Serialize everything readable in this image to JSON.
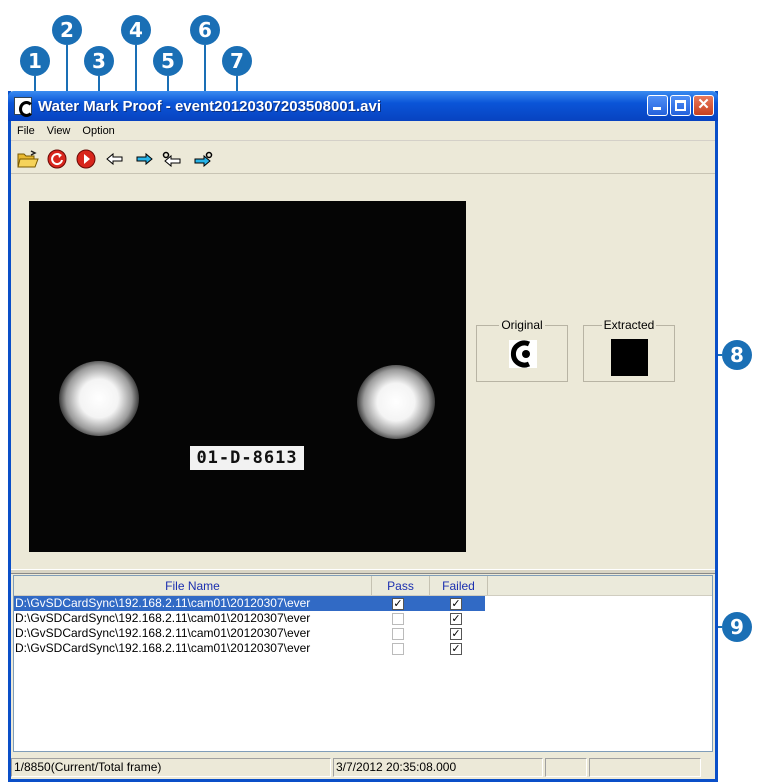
{
  "callouts": [
    "1",
    "2",
    "3",
    "4",
    "5",
    "6",
    "7",
    "8",
    "9"
  ],
  "window": {
    "title": "Water Mark Proof - event20120307203508001.avi",
    "controls": {
      "close_glyph": "✕"
    }
  },
  "menu": [
    "File",
    "View",
    "Option"
  ],
  "toolbar": [
    {
      "icon": "open-folder-icon"
    },
    {
      "icon": "rewind-icon"
    },
    {
      "icon": "play-icon"
    },
    {
      "icon": "prev-arrow-icon"
    },
    {
      "icon": "next-arrow-icon"
    },
    {
      "icon": "prev-marked-icon"
    },
    {
      "icon": "next-marked-icon"
    }
  ],
  "video": {
    "plate_text": "01-D-8613"
  },
  "watermark": {
    "original_label": "Original",
    "extracted_label": "Extracted"
  },
  "file_list": {
    "columns": [
      "File Name",
      "Pass",
      "Failed"
    ],
    "rows": [
      {
        "name": "D:\\GvSDCardSync\\192.168.2.11\\cam01\\20120307\\ever",
        "pass": true,
        "failed": true,
        "selected": true
      },
      {
        "name": "D:\\GvSDCardSync\\192.168.2.11\\cam01\\20120307\\ever",
        "pass": false,
        "failed": true,
        "selected": false
      },
      {
        "name": "D:\\GvSDCardSync\\192.168.2.11\\cam01\\20120307\\ever",
        "pass": false,
        "failed": true,
        "selected": false
      },
      {
        "name": "D:\\GvSDCardSync\\192.168.2.11\\cam01\\20120307\\ever",
        "pass": false,
        "failed": true,
        "selected": false
      }
    ]
  },
  "status": {
    "frame": "1/8850(Current/Total frame)",
    "timestamp": "3/7/2012 20:35:08.000"
  },
  "colors": {
    "callout": "#1a6fb5",
    "titlebar": "#0a55d8",
    "selection": "#316ac5"
  }
}
